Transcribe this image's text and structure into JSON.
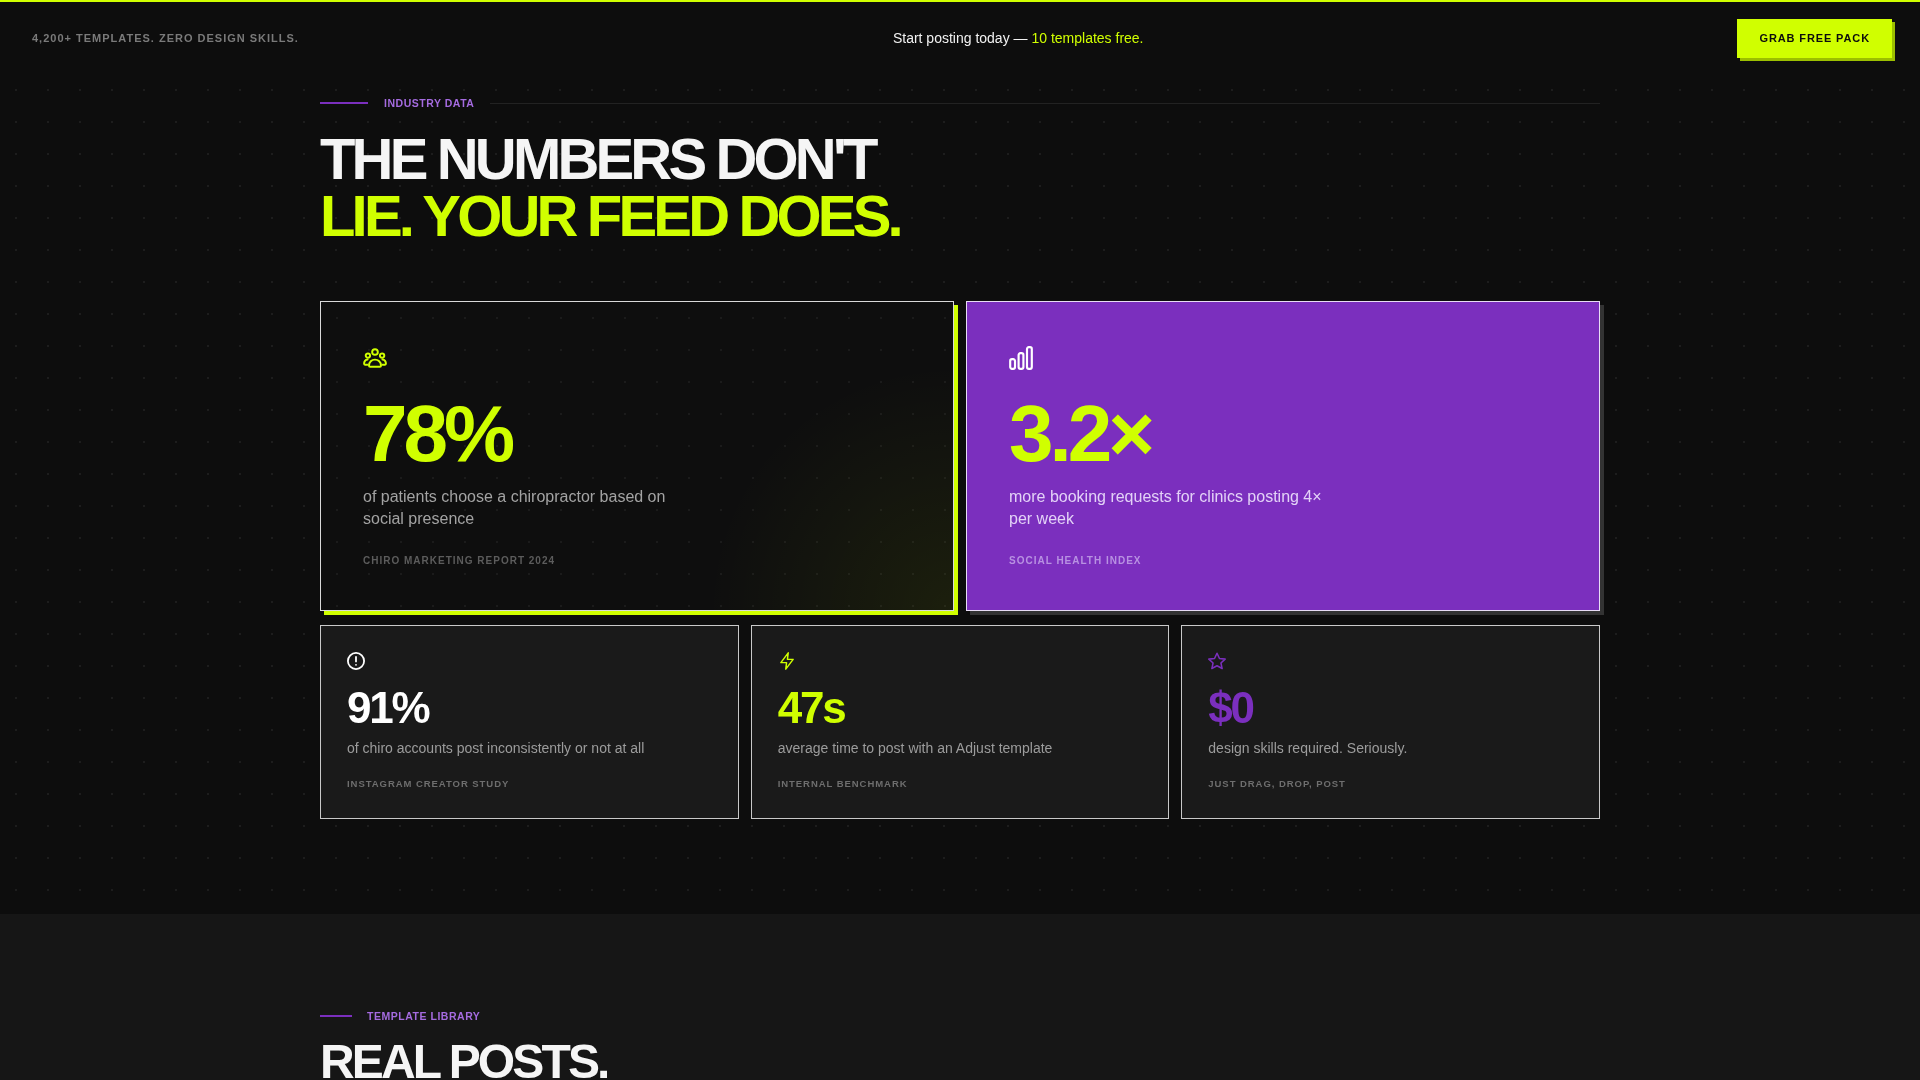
{
  "top_bar": {
    "tagline": "4,200+ TEMPLATES. ZERO DESIGN SKILLS.",
    "promo": {
      "text": "Start posting today —",
      "highlight": "10 templates free."
    },
    "button": "GRAB FREE PACK"
  },
  "industry_data": {
    "eyebrow": "INDUSTRY DATA",
    "heading": {
      "text": "THE NUMBERS DON'T",
      "highlight": "LIE. YOUR FEED DOES."
    },
    "featured_stats": [
      {
        "kind": "outline",
        "value": "78%",
        "description": "of patients choose a chiropractor based on social presence",
        "source": "CHIRO MARKETING REPORT 2024"
      },
      {
        "kind": "filled",
        "value": "3.2×",
        "description": "more booking requests for clinics posting 4× per week",
        "source": "SOCIAL HEALTH INDEX"
      }
    ],
    "stats": [
      {
        "value": "91%",
        "color": "#ffffff",
        "description": "of chiro accounts post inconsistently or not at all",
        "source": "INSTAGRAM CREATOR STUDY"
      },
      {
        "value": "47s",
        "color": "#d0ff00",
        "description": "average time to post with an Adjust template",
        "source": "INTERNAL BENCHMARK"
      },
      {
        "value": "$0",
        "color": "#7b2fbe",
        "description": "design skills required. Seriously.",
        "source": "JUST DRAG, DROP, POST"
      }
    ]
  },
  "template_library": {
    "eyebrow": "TEMPLATE LIBRARY",
    "title": "REAL POSTS."
  }
}
